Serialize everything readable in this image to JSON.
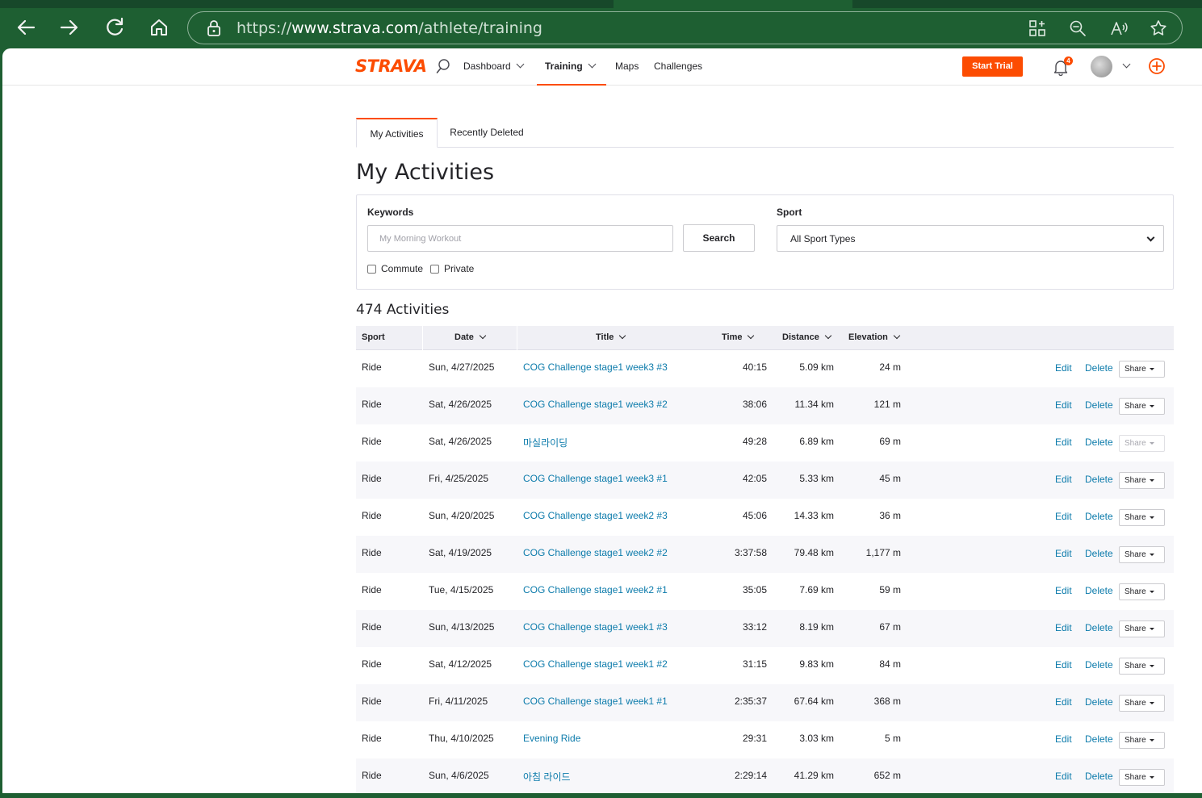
{
  "browser": {
    "url_prefix": "https://",
    "url_host": "www.strava.com",
    "url_path": "/athlete/training"
  },
  "header": {
    "logo": "STRAVA",
    "nav": {
      "dashboard": "Dashboard",
      "training": "Training",
      "maps": "Maps",
      "challenges": "Challenges"
    },
    "start_trial": "Start Trial",
    "notification_count": "4"
  },
  "tabs": {
    "my_activities": "My Activities",
    "recently_deleted": "Recently Deleted"
  },
  "page_title": "My Activities",
  "filters": {
    "keywords_label": "Keywords",
    "keywords_placeholder": "My Morning Workout",
    "search_label": "Search",
    "sport_label": "Sport",
    "sport_value": "All Sport Types",
    "commute_label": "Commute",
    "private_label": "Private"
  },
  "activity_count": "474 Activities",
  "table": {
    "headers": {
      "sport": "Sport",
      "date": "Date",
      "title": "Title",
      "time": "Time",
      "distance": "Distance",
      "elevation": "Elevation"
    },
    "edit_label": "Edit",
    "delete_label": "Delete",
    "share_label": "Share",
    "rows": [
      {
        "sport": "Ride",
        "date": "Sun, 4/27/2025",
        "title": "COG Challenge stage1 week3 #3",
        "time": "40:15",
        "distance": "5.09 km",
        "elevation": "24 m"
      },
      {
        "sport": "Ride",
        "date": "Sat, 4/26/2025",
        "title": "COG Challenge stage1 week3 #2",
        "time": "38:06",
        "distance": "11.34 km",
        "elevation": "121 m"
      },
      {
        "sport": "Ride",
        "date": "Sat, 4/26/2025",
        "title": "마실라이딩",
        "time": "49:28",
        "distance": "6.89 km",
        "elevation": "69 m"
      },
      {
        "sport": "Ride",
        "date": "Fri, 4/25/2025",
        "title": "COG Challenge stage1 week3 #1",
        "time": "42:05",
        "distance": "5.33 km",
        "elevation": "45 m"
      },
      {
        "sport": "Ride",
        "date": "Sun, 4/20/2025",
        "title": "COG Challenge stage1 week2 #3",
        "time": "45:06",
        "distance": "14.33 km",
        "elevation": "36 m"
      },
      {
        "sport": "Ride",
        "date": "Sat, 4/19/2025",
        "title": "COG Challenge stage1 week2 #2",
        "time": "3:37:58",
        "distance": "79.48 km",
        "elevation": "1,177 m"
      },
      {
        "sport": "Ride",
        "date": "Tue, 4/15/2025",
        "title": "COG Challenge stage1 week2 #1",
        "time": "35:05",
        "distance": "7.69 km",
        "elevation": "59 m"
      },
      {
        "sport": "Ride",
        "date": "Sun, 4/13/2025",
        "title": "COG Challenge stage1 week1 #3",
        "time": "33:12",
        "distance": "8.19 km",
        "elevation": "67 m"
      },
      {
        "sport": "Ride",
        "date": "Sat, 4/12/2025",
        "title": "COG Challenge stage1 week1 #2",
        "time": "31:15",
        "distance": "9.83 km",
        "elevation": "84 m"
      },
      {
        "sport": "Ride",
        "date": "Fri, 4/11/2025",
        "title": "COG Challenge stage1 week1 #1",
        "time": "2:35:37",
        "distance": "67.64 km",
        "elevation": "368 m"
      },
      {
        "sport": "Ride",
        "date": "Thu, 4/10/2025",
        "title": "Evening Ride",
        "time": "29:31",
        "distance": "3.03 km",
        "elevation": "5 m"
      },
      {
        "sport": "Ride",
        "date": "Sun, 4/6/2025",
        "title": "아침 라이드",
        "time": "2:29:14",
        "distance": "41.29 km",
        "elevation": "652 m"
      }
    ]
  },
  "colors": {
    "brand": "#fc4c02",
    "link": "#0c7bab",
    "browser_frame": "#1e5f32"
  }
}
